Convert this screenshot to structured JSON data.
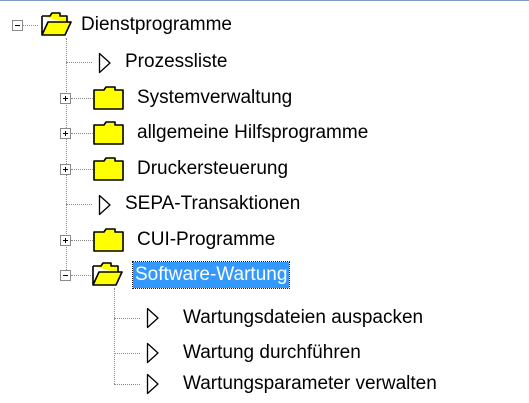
{
  "tree": {
    "root": {
      "label": "Dienstprogramme",
      "expanded": true,
      "icon": "folder-open-icon"
    },
    "children": [
      {
        "label": "Prozessliste",
        "type": "item",
        "icon": "triangle-right-icon"
      },
      {
        "label": "Systemverwaltung",
        "type": "folder",
        "expanded": false,
        "icon": "folder-icon"
      },
      {
        "label": "allgemeine Hilfsprogramme",
        "type": "folder",
        "expanded": false,
        "icon": "folder-icon"
      },
      {
        "label": "Druckersteuerung",
        "type": "folder",
        "expanded": false,
        "icon": "folder-icon"
      },
      {
        "label": "SEPA-Transaktionen",
        "type": "item",
        "icon": "triangle-right-icon"
      },
      {
        "label": "CUI-Programme",
        "type": "folder",
        "expanded": false,
        "icon": "folder-icon"
      },
      {
        "label": "Software-Wartung",
        "type": "folder",
        "expanded": true,
        "selected": true,
        "icon": "folder-open-icon",
        "children": [
          {
            "label": "Wartungsdateien auspacken",
            "type": "item",
            "icon": "triangle-right-icon"
          },
          {
            "label": "Wartung durchführen",
            "type": "item",
            "icon": "triangle-right-icon"
          },
          {
            "label": "Wartungsparameter verwalten",
            "type": "item",
            "icon": "triangle-right-icon"
          }
        ]
      }
    ]
  },
  "colors": {
    "selection_bg": "#3399ff",
    "folder_fill": "#ffff00",
    "tree_lines": "#8a8a8a"
  }
}
